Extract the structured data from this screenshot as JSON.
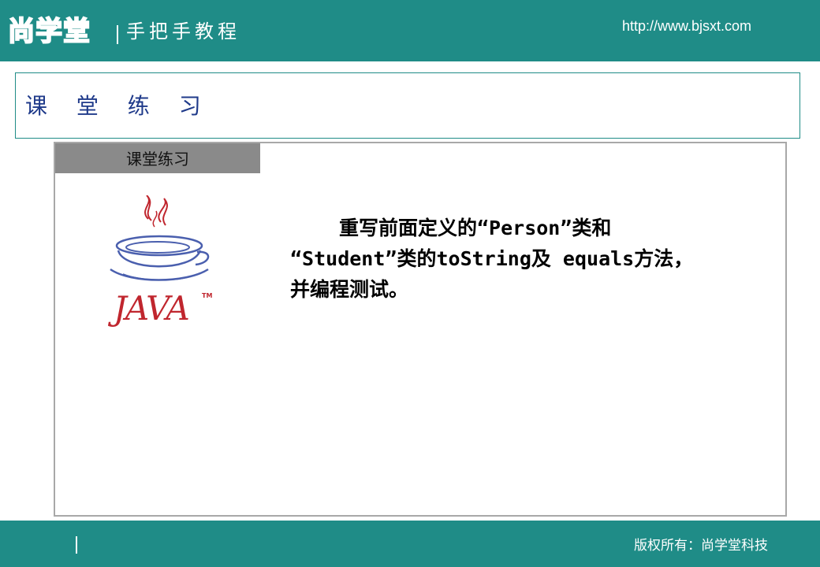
{
  "header": {
    "logo_text": "尚学堂",
    "subtitle": "手把手教程",
    "url": "http://www.bjsxt.com"
  },
  "title_bar": {
    "title": "课 堂 练 习"
  },
  "panel": {
    "tab_label": "课堂练习",
    "logo": {
      "brand": "JAVA",
      "trademark": "TM"
    },
    "exercise_lines": [
      "重写前面定义的“Person”类和",
      "“Student”类的toString及 equals方法，",
      "并编程测试。"
    ]
  },
  "footer": {
    "copyright": "版权所有：尚学堂科技"
  },
  "colors": {
    "brand_teal": "#1f8c87",
    "title_blue": "#1f3a8a",
    "tab_gray": "#8a8a8a",
    "java_red": "#c0262e",
    "java_blue": "#4a5fae"
  }
}
